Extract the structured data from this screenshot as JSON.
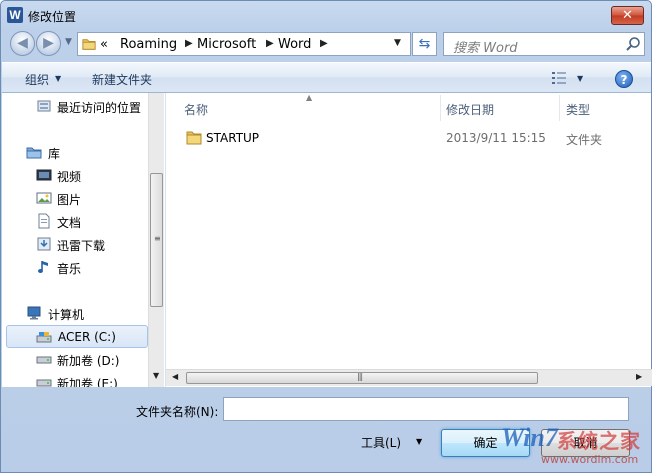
{
  "window": {
    "title": "修改位置",
    "app_icon_letter": "W",
    "close_symbol": "✕"
  },
  "address_bar": {
    "overflow_symbol": "«",
    "crumbs": [
      "Roaming",
      "Microsoft",
      "Word"
    ],
    "search_placeholder": "搜索 Word"
  },
  "toolbar": {
    "organize_label": "组织",
    "new_folder_label": "新建文件夹",
    "help_symbol": "?"
  },
  "nav_pane": {
    "items": [
      {
        "label": "最近访问的位置",
        "icon": "recent-places-icon"
      },
      {
        "label": "库",
        "icon": "library-icon"
      },
      {
        "label": "视频",
        "icon": "video-icon"
      },
      {
        "label": "图片",
        "icon": "pictures-icon"
      },
      {
        "label": "文档",
        "icon": "documents-icon"
      },
      {
        "label": "迅雷下载",
        "icon": "download-icon"
      },
      {
        "label": "音乐",
        "icon": "music-icon"
      },
      {
        "label": "计算机",
        "icon": "computer-icon"
      },
      {
        "label": "ACER (C:)",
        "icon": "drive-c-icon"
      },
      {
        "label": "新加卷 (D:)",
        "icon": "drive-icon"
      },
      {
        "label": "新加卷 (E:)",
        "icon": "drive-icon"
      }
    ],
    "selected_item": "ACER (C:)"
  },
  "file_list": {
    "columns": [
      "名称",
      "修改日期",
      "类型"
    ],
    "rows": [
      {
        "name": "STARTUP",
        "modified": "2013/9/11 15:15",
        "type": "文件夹",
        "icon": "folder-icon"
      }
    ]
  },
  "bottom": {
    "folder_name_label": "文件夹名称(N):",
    "folder_name_value": "",
    "tools_label": "工具(L)",
    "ok_label": "确定",
    "cancel_label": "取消"
  },
  "watermark": {
    "logo_text": "Win7",
    "cn_text": "系统之家",
    "url": "www.wordlm.com"
  },
  "colors": {
    "window_frame": "#b9cde8",
    "accent": "#1c5fb8",
    "close_red": "#c23a22"
  }
}
